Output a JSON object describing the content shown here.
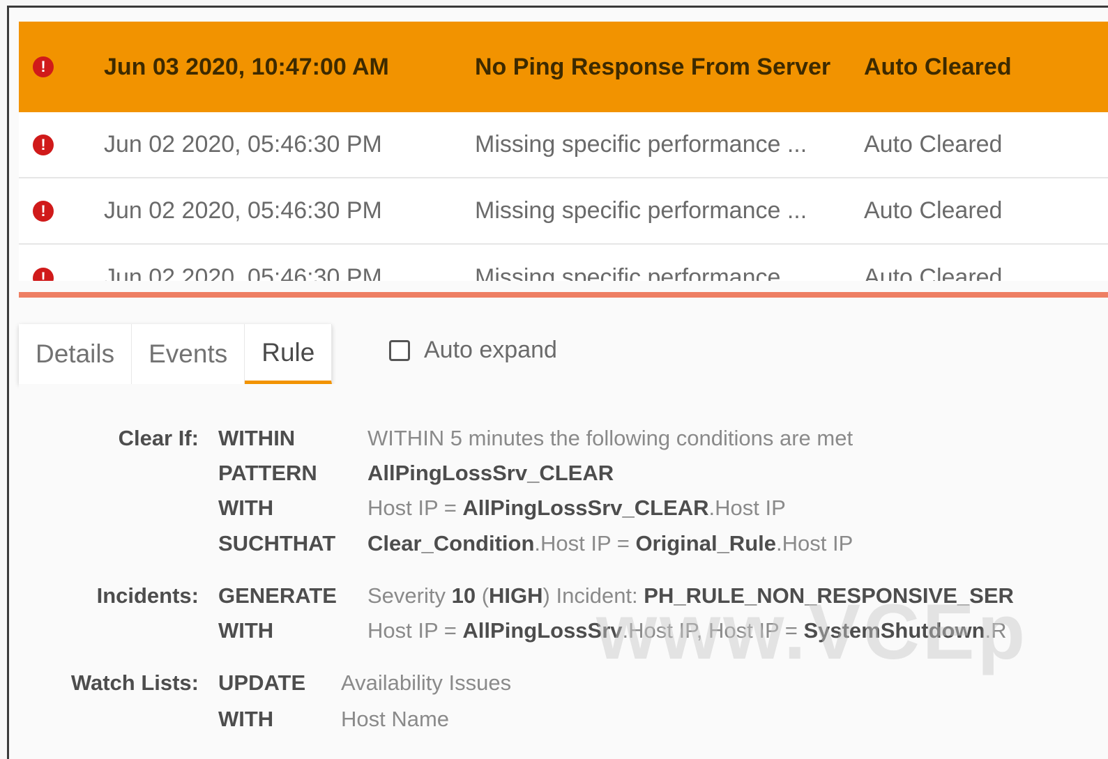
{
  "incidents": [
    {
      "time": "Jun 03 2020, 10:47:00 AM",
      "name": "No Ping Response From Server",
      "status": "Auto Cleared",
      "selected": true
    },
    {
      "time": "Jun 02 2020, 05:46:30 PM",
      "name": "Missing specific performance ...",
      "status": "Auto Cleared"
    },
    {
      "time": "Jun 02 2020, 05:46:30 PM",
      "name": "Missing specific performance ...",
      "status": "Auto Cleared"
    },
    {
      "time": "Jun 02 2020, 05:46:30 PM",
      "name": "Missing specific performance ...",
      "status": "Auto Cleared"
    }
  ],
  "severity_glyph": "!",
  "tabs": [
    "Details",
    "Events",
    "Rule"
  ],
  "active_tab": "Rule",
  "auto_expand_label": "Auto expand",
  "rule": {
    "clear_if_label": "Clear If:",
    "within_kw": "WITHIN",
    "within_text": "WITHIN 5 minutes the following conditions are met",
    "pattern_kw": "PATTERN",
    "pattern_text": "AllPingLossSrv_CLEAR",
    "with_kw": "WITH",
    "with1_pre": "Host IP = ",
    "with1_bold": "AllPingLossSrv_CLEAR",
    "with1_post": ".Host IP",
    "suchthat_kw": "SUCHTHAT",
    "such_a": "Clear_Condition",
    "such_b": ".Host IP = ",
    "such_c": "Original_Rule",
    "such_d": ".Host IP",
    "incidents_label": "Incidents:",
    "generate_kw": "GENERATE",
    "gen_a": "Severity ",
    "gen_b": "10",
    "gen_c": " (",
    "gen_d": "HIGH",
    "gen_e": ") Incident: ",
    "gen_f": "PH_RULE_NON_RESPONSIVE_SER",
    "with2_a": "Host IP = ",
    "with2_b": "AllPingLossSrv",
    "with2_c": ".Host IP, Host IP = ",
    "with2_d": "SystemShutdown",
    "with2_e": ".R",
    "watch_label": "Watch Lists:",
    "update_kw": "UPDATE",
    "update_text": "Availability Issues",
    "with3_text": "Host Name"
  },
  "watermark": "www.VCEp",
  "colors": {
    "selected_row": "#f29300",
    "severity": "#d01a1a",
    "divider": "#ee7f63",
    "tab_underline": "#f29300"
  }
}
